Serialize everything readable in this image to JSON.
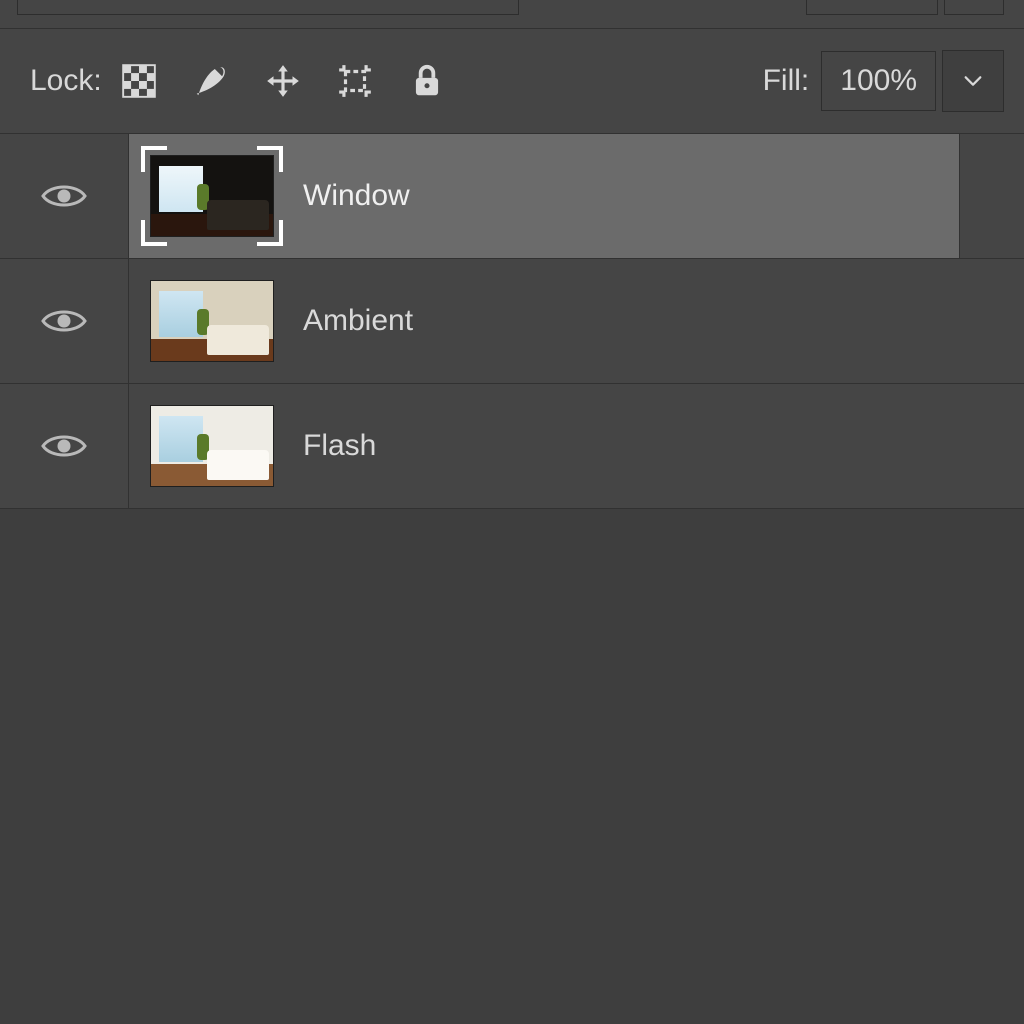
{
  "toolbar": {
    "lock_label": "Lock:",
    "fill_label": "Fill:",
    "fill_value": "100%"
  },
  "layers": [
    {
      "name": "Window",
      "selected": true,
      "thumb_variant": "v-window"
    },
    {
      "name": "Ambient",
      "selected": false,
      "thumb_variant": "v-ambient"
    },
    {
      "name": "Flash",
      "selected": false,
      "thumb_variant": "v-flash"
    }
  ]
}
